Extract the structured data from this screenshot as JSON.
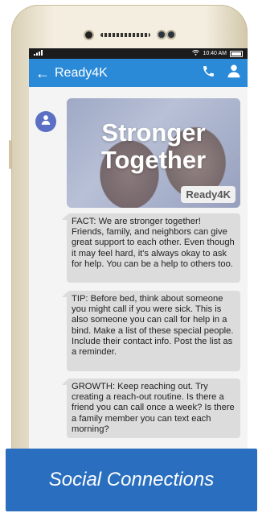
{
  "status_bar": {
    "time": "10:40 AM"
  },
  "app_bar": {
    "back_symbol": "←",
    "title": "Ready4K"
  },
  "hero_image": {
    "headline": "Stronger\nTogether",
    "badge": "Ready4K"
  },
  "messages": [
    "FACT: We are stronger together! Friends, family, and neighbors can give great support to each other. Even though it may feel hard, it's always okay to ask for help. You can be a help to others too.",
    "TIP: Before bed, think about someone you might call if you were sick. This is also someone you can call for help in a bind. Make a list of these special people. Include their contact info. Post the list as a reminder.",
    "GROWTH: Keep reaching out. Try creating a reach-out routine. Is there a friend you can call once a week? Is there a family member you can text each morning?"
  ],
  "banner": {
    "label": "Social Connections"
  },
  "colors": {
    "app_bar": "#2b8ad8",
    "banner": "#2a6fbf",
    "bubble": "#dcdcdc",
    "avatar": "#5b6fc4"
  },
  "icons": [
    "back-arrow-icon",
    "phone-icon",
    "person-icon",
    "avatar-person-icon",
    "wifi-icon",
    "signal-icon",
    "battery-icon"
  ]
}
